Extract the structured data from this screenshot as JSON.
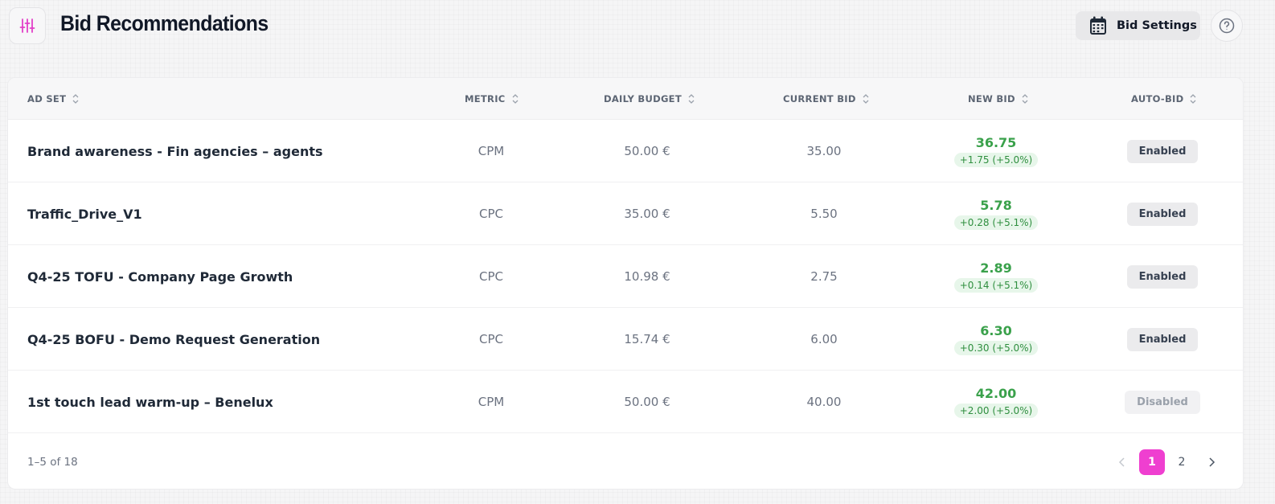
{
  "header": {
    "title": "Bid Recommendations",
    "menu_icon": "sliders-icon",
    "settings_label": "Bid Settings",
    "settings_icon": "calendar-icon",
    "help_icon": "help-circle-icon",
    "accent_color": "#ef3fd0"
  },
  "table": {
    "columns": [
      "AD SET",
      "METRIC",
      "DAILY BUDGET",
      "CURRENT BID",
      "NEW BID",
      "AUTO-BID"
    ],
    "rows": [
      {
        "ad_set": "Brand awareness - Fin agencies – agents",
        "metric": "CPM",
        "daily_budget": "50.00 €",
        "current_bid": "35.00",
        "new_bid": "36.75",
        "delta": "+1.75 (+5.0%)",
        "auto_bid": "Enabled"
      },
      {
        "ad_set": "Traffic_Drive_V1",
        "metric": "CPC",
        "daily_budget": "35.00 €",
        "current_bid": "5.50",
        "new_bid": "5.78",
        "delta": "+0.28 (+5.1%)",
        "auto_bid": "Enabled"
      },
      {
        "ad_set": "Q4-25 TOFU - Company Page Growth",
        "metric": "CPC",
        "daily_budget": "10.98 €",
        "current_bid": "2.75",
        "new_bid": "2.89",
        "delta": "+0.14 (+5.1%)",
        "auto_bid": "Enabled"
      },
      {
        "ad_set": "Q4-25 BOFU - Demo Request Generation",
        "metric": "CPC",
        "daily_budget": "15.74 €",
        "current_bid": "6.00",
        "new_bid": "6.30",
        "delta": "+0.30 (+5.0%)",
        "auto_bid": "Enabled"
      },
      {
        "ad_set": "1st touch lead warm-up – Benelux",
        "metric": "CPM",
        "daily_budget": "50.00 €",
        "current_bid": "40.00",
        "new_bid": "42.00",
        "delta": "+2.00 (+5.0%)",
        "auto_bid": "Disabled"
      }
    ]
  },
  "pagination": {
    "range_text": "1–5 of 18",
    "pages": [
      "1",
      "2"
    ],
    "current_page": "1"
  }
}
